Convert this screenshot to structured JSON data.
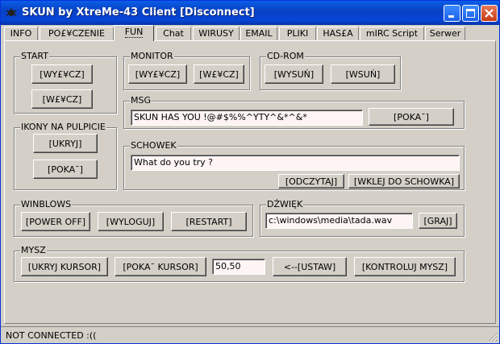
{
  "window": {
    "title": "SKUN by XtreMe-43 Client [Disconnect]",
    "title_bar_color": "#0A5EE8",
    "close_button_color": "#E8795C"
  },
  "tabs": [
    {
      "label": "INFO"
    },
    {
      "label": "PO£¥CZENIE"
    },
    {
      "label": "FUN",
      "active": true
    },
    {
      "label": "Chat"
    },
    {
      "label": "WIRUSY"
    },
    {
      "label": "EMAIL"
    },
    {
      "label": "PLIKI"
    },
    {
      "label": "HAS£A"
    },
    {
      "label": "mIRC Script"
    },
    {
      "label": "Serwer"
    }
  ],
  "start": {
    "label": "START",
    "on_button": "[WY£¥CZ]",
    "off_button": "[W£¥CZ]"
  },
  "desktop_icons": {
    "label": "IKONY NA PULPICIE",
    "hide_button": "[UKRYJ]",
    "show_button": "[POKA¯]"
  },
  "monitor": {
    "label": "MONITOR",
    "off_button": "[WY£¥CZ]",
    "on_button": "[W£¥CZ]"
  },
  "cdrom": {
    "label": "CD-ROM",
    "eject_button": "[WYSUŃ]",
    "insert_button": "[WSUŃ]"
  },
  "msg": {
    "label": "MSG",
    "value": "SKUN HAS YOU !@#$%%^YTY^&*^&*",
    "show_button": "[POKA¯]"
  },
  "clipboard": {
    "label": "SCHOWEK",
    "value": "What do you try ?",
    "read_button": "[ODCZYTAJ]",
    "paste_button": "[WKLEJ DO SCHOWKA]"
  },
  "winblows": {
    "label": "WINBLOWS",
    "power_off_button": "[POWER OFF]",
    "logout_button": "[WYLOGUJ]",
    "restart_button": "[RESTART]"
  },
  "sound": {
    "label": "DŹWIĘK",
    "value": "c:\\windows\\media\\tada.wav",
    "play_button": "[GRAJ]"
  },
  "mouse": {
    "label": "MYSZ",
    "hide_button": "[UKRYJ KURSOR]",
    "show_button": "[POKA¯ KURSOR]",
    "coords_value": "50,50",
    "set_button": "<--[USTAW]",
    "control_button": "[KONTROLUJ MYSZ]"
  },
  "status": {
    "text": "NOT CONNECTED :(("
  }
}
